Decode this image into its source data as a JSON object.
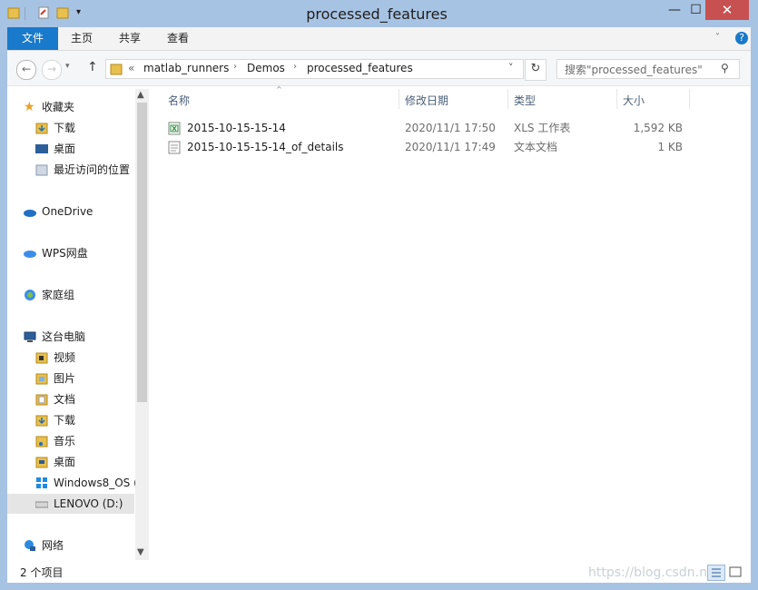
{
  "window": {
    "title": "processed_features",
    "controls": {
      "minimize": "—",
      "maximize": "☐",
      "close": "✕"
    }
  },
  "ribbon": {
    "tabs": [
      "文件",
      "主页",
      "共享",
      "查看"
    ]
  },
  "address": {
    "prefix": "«",
    "crumbs": [
      "matlab_runners",
      "Demos",
      "processed_features"
    ],
    "search_placeholder": "搜索\"processed_features\""
  },
  "navpane": {
    "favorites": {
      "label": "收藏夹",
      "items": [
        "下载",
        "桌面",
        "最近访问的位置"
      ]
    },
    "onedrive": "OneDrive",
    "wps": "WPS网盘",
    "homegroup": "家庭组",
    "thispc": {
      "label": "这台电脑",
      "items": [
        "视频",
        "图片",
        "文档",
        "下载",
        "音乐",
        "桌面",
        "Windows8_OS (",
        "LENOVO (D:)"
      ]
    },
    "network": "网络"
  },
  "columns": {
    "name": "名称",
    "modified": "修改日期",
    "type": "类型",
    "size": "大小"
  },
  "files": [
    {
      "name": "2015-10-15-15-14",
      "modified": "2020/11/1 17:50",
      "type": "XLS 工作表",
      "size": "1,592 KB",
      "icon": "excel-file-icon"
    },
    {
      "name": "2015-10-15-15-14_of_details",
      "modified": "2020/11/1 17:49",
      "type": "文本文档",
      "size": "1 KB",
      "icon": "text-file-icon"
    }
  ],
  "status": {
    "count": "2 个项目"
  },
  "watermark": "https://blog.csdn.n",
  "colors": {
    "accent": "#1979ca",
    "close": "#c75050",
    "frame": "#a7c3e3"
  }
}
